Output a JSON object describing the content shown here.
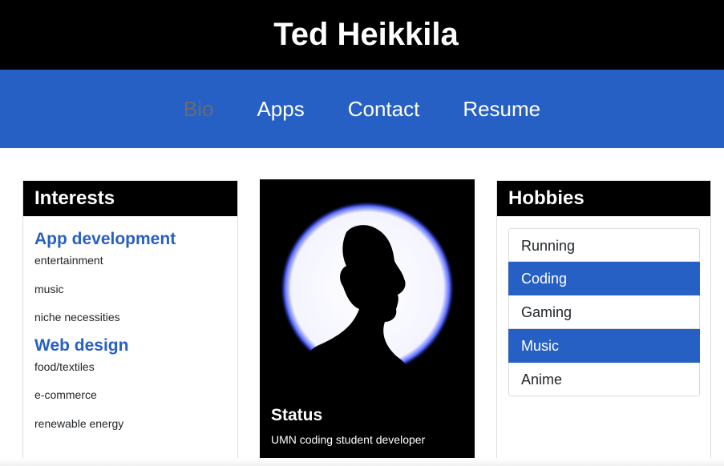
{
  "header": {
    "title": "Ted Heikkila"
  },
  "nav": {
    "items": [
      {
        "label": "Bio",
        "active": true
      },
      {
        "label": "Apps",
        "active": false
      },
      {
        "label": "Contact",
        "active": false
      },
      {
        "label": "Resume",
        "active": false
      }
    ]
  },
  "interests": {
    "title": "Interests",
    "groups": [
      {
        "heading": "App development",
        "items": [
          "entertainment",
          "music",
          "niche necessities"
        ]
      },
      {
        "heading": "Web design",
        "items": [
          "food/textiles",
          "e-commerce",
          "renewable energy"
        ]
      }
    ]
  },
  "profile": {
    "image_icon": "person-silhouette-icon",
    "status_title": "Status",
    "status_text": "UMN coding student developer"
  },
  "hobbies": {
    "title": "Hobbies",
    "items": [
      {
        "label": "Running",
        "active": false
      },
      {
        "label": "Coding",
        "active": true
      },
      {
        "label": "Gaming",
        "active": false
      },
      {
        "label": "Music",
        "active": true
      },
      {
        "label": "Anime",
        "active": false
      }
    ]
  },
  "colors": {
    "header_bg": "#000000",
    "nav_bg": "#2760c4",
    "accent": "#2760c4",
    "active_nav_text": "#6b6b6b"
  }
}
